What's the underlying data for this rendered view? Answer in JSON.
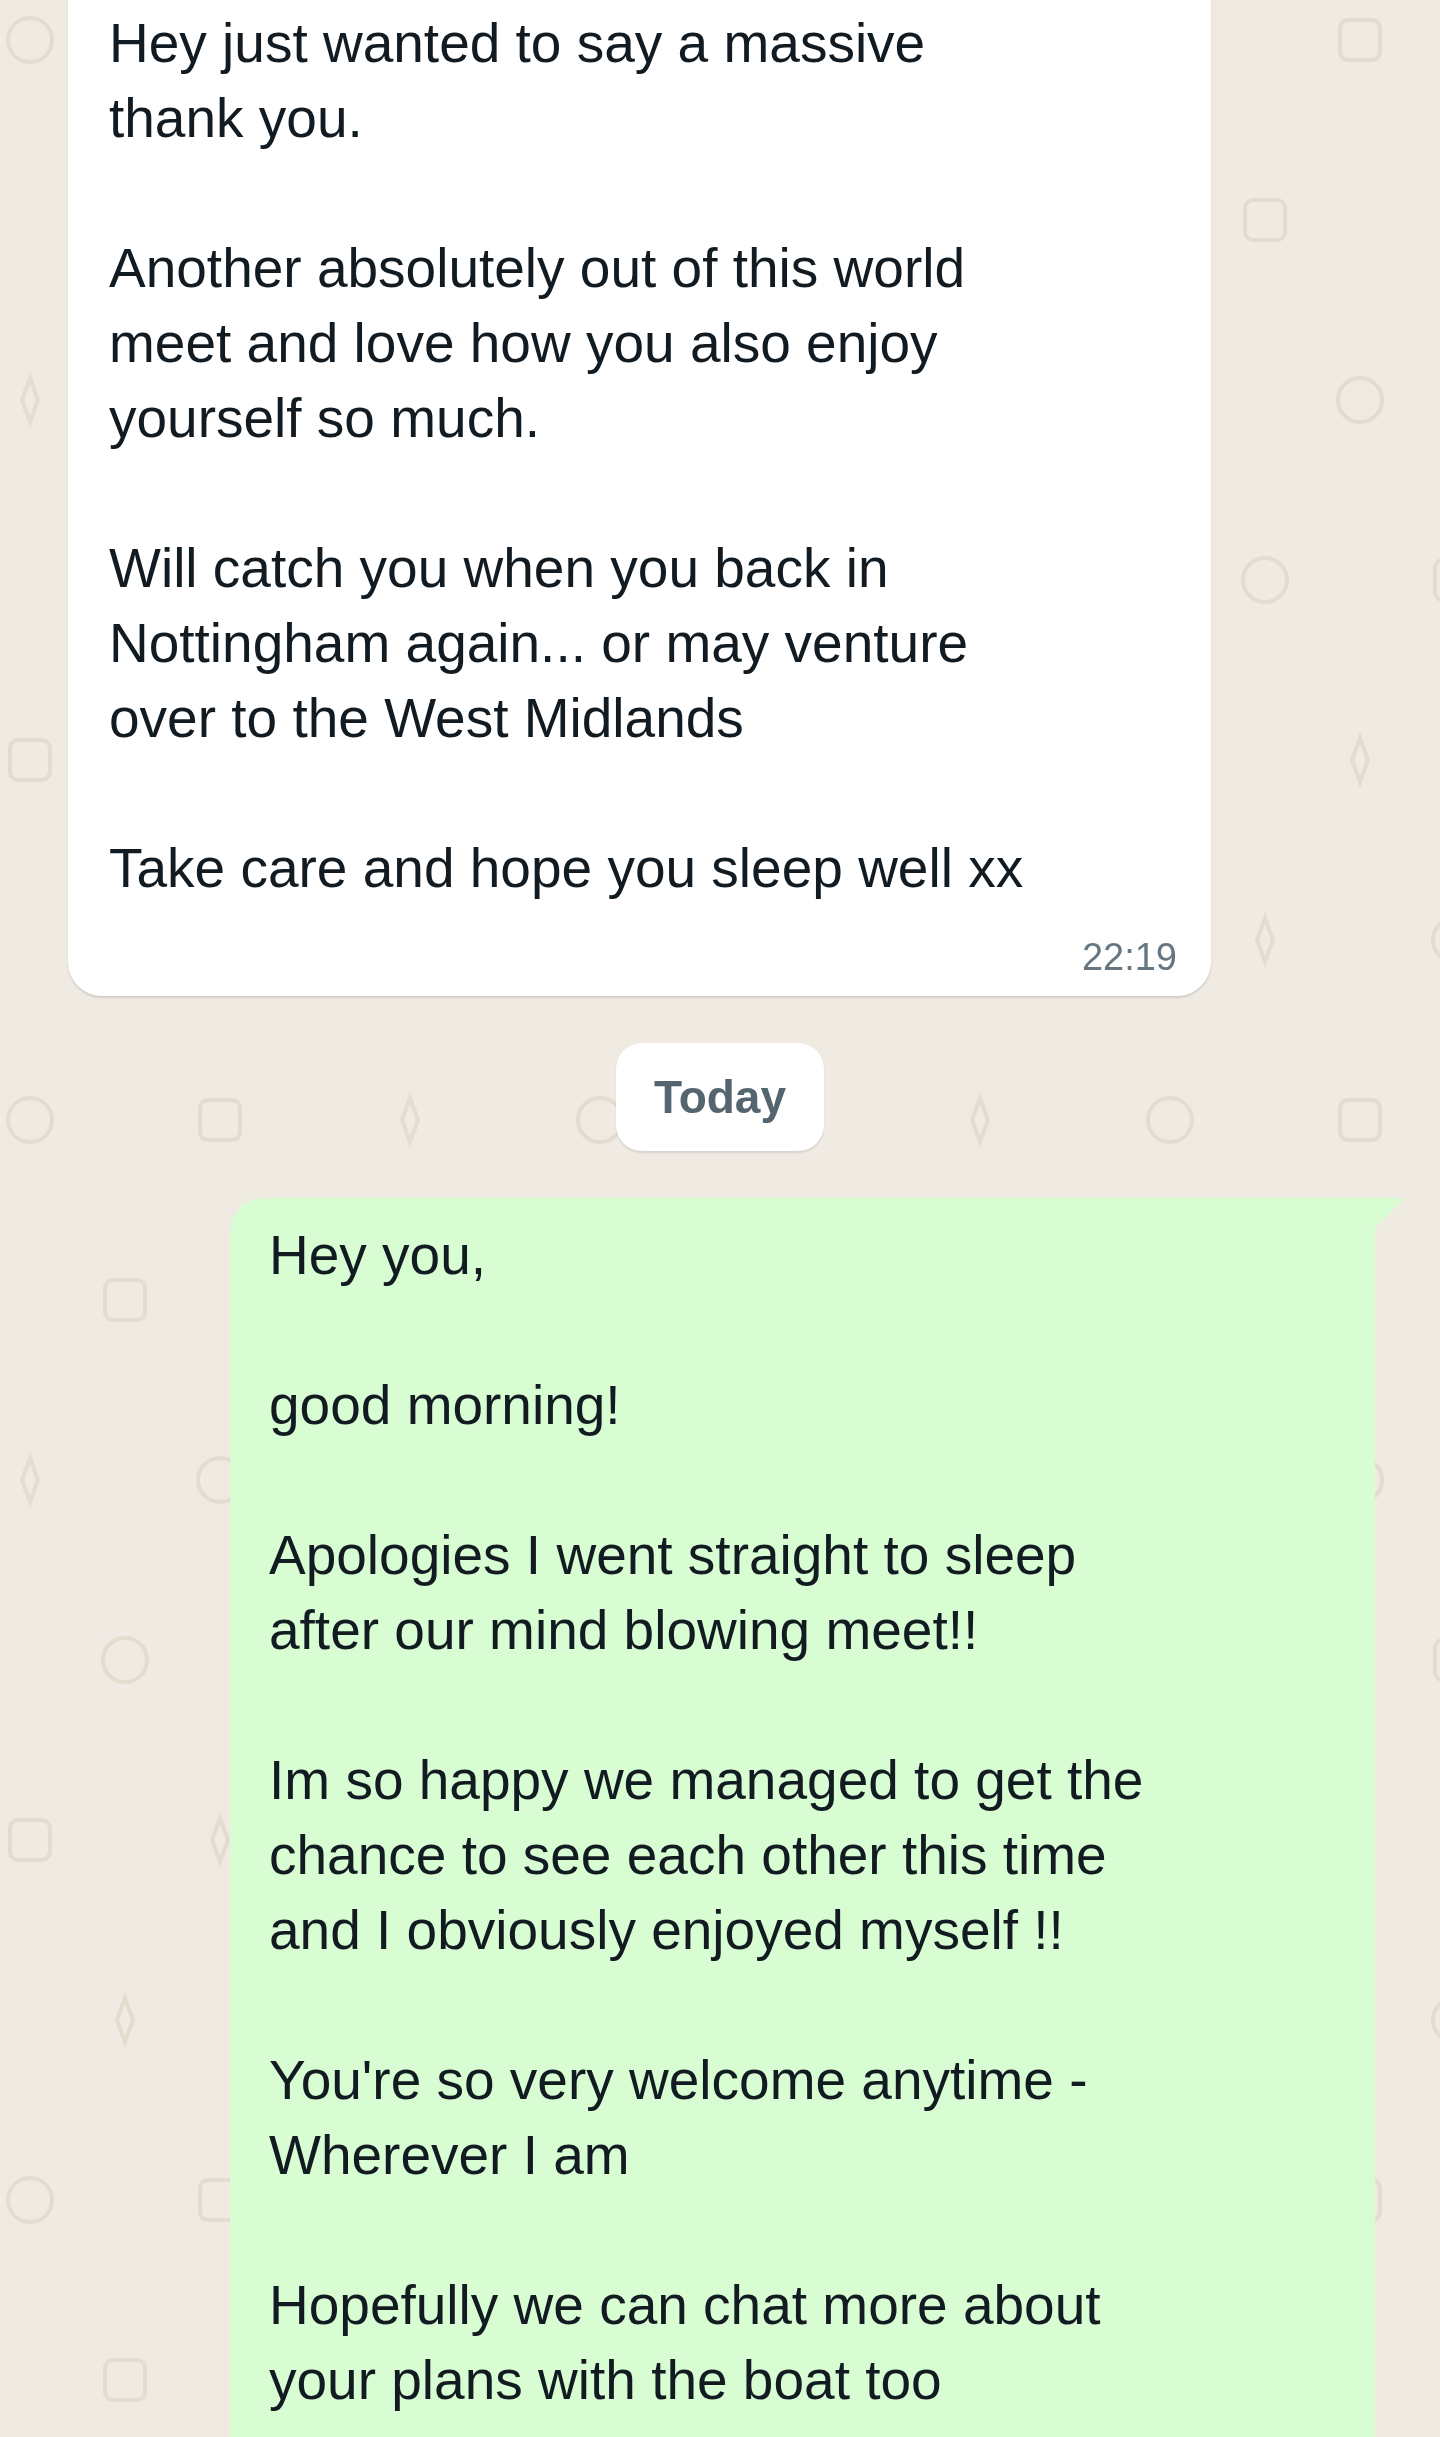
{
  "messages": [
    {
      "kind": "incoming",
      "paragraphs": [
        "Hey just wanted to say a massive\nthank you.",
        "Another absolutely out of this world\nmeet and love how you also enjoy\nyourself so much.",
        "Will catch you when you back in\nNottingham again... or may venture\nover to the West Midlands",
        "Take care and hope you sleep well xx"
      ],
      "time": "22:19"
    },
    {
      "kind": "date",
      "label": "Today"
    },
    {
      "kind": "outgoing",
      "paragraphs": [
        "Hey you,",
        "good morning!",
        "Apologies I went straight to sleep\nafter our mind blowing meet!!",
        "Im so happy we managed to get the\nchance to see each other this time\nand I obviously enjoyed myself !!",
        "You're so very welcome anytime -\nWherever I am",
        "Hopefully we can chat more about\nyour plans with the boat too"
      ]
    }
  ]
}
